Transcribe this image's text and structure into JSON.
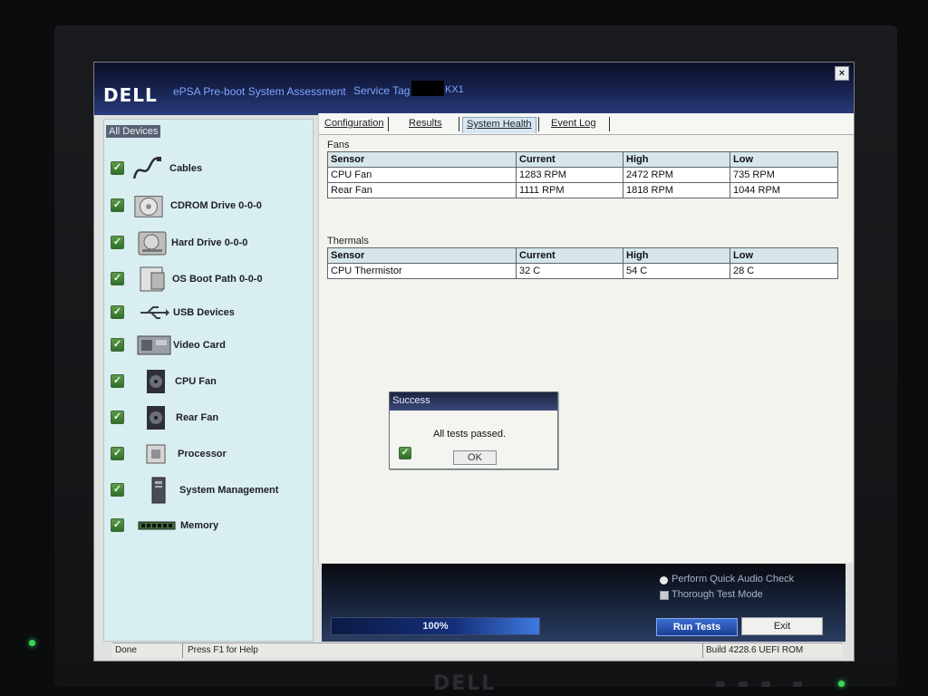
{
  "window": {
    "logo": "DELL",
    "app_title": "ePSA Pre-boot System Assessment",
    "service_tag_label": "Service Tag",
    "service_tag_suffix": "KX1",
    "close_label": "×"
  },
  "sidebar": {
    "header": "All Devices",
    "items": [
      {
        "label": "Cables",
        "icon": "cable-icon",
        "checked": true
      },
      {
        "label": "CDROM Drive 0-0-0",
        "icon": "cdrom-icon",
        "checked": true
      },
      {
        "label": "Hard Drive 0-0-0",
        "icon": "hard-drive-icon",
        "checked": true
      },
      {
        "label": "OS Boot Path 0-0-0",
        "icon": "boot-path-icon",
        "checked": true
      },
      {
        "label": "USB Devices",
        "icon": "usb-icon",
        "checked": true
      },
      {
        "label": "Video Card",
        "icon": "video-card-icon",
        "checked": true
      },
      {
        "label": "CPU Fan",
        "icon": "fan-icon",
        "checked": true
      },
      {
        "label": "Rear Fan",
        "icon": "fan-icon",
        "checked": true
      },
      {
        "label": "Processor",
        "icon": "processor-icon",
        "checked": true
      },
      {
        "label": "System Management",
        "icon": "system-management-icon",
        "checked": true
      },
      {
        "label": "Memory",
        "icon": "memory-icon",
        "checked": true
      }
    ]
  },
  "tabs": [
    {
      "label": "Configuration",
      "active": false
    },
    {
      "label": "Results",
      "active": false
    },
    {
      "label": "System Health",
      "active": true
    },
    {
      "label": "Event Log",
      "active": false
    }
  ],
  "fans": {
    "title": "Fans",
    "headers": [
      "Sensor",
      "Current",
      "High",
      "Low"
    ],
    "rows": [
      [
        "CPU Fan",
        "1283 RPM",
        "2472 RPM",
        "735 RPM"
      ],
      [
        "Rear Fan",
        "1111 RPM",
        "1818 RPM",
        "1044 RPM"
      ]
    ]
  },
  "thermals": {
    "title": "Thermals",
    "headers": [
      "Sensor",
      "Current",
      "High",
      "Low"
    ],
    "rows": [
      [
        "CPU Thermistor",
        "32 C",
        "54 C",
        "28 C"
      ]
    ]
  },
  "dialog": {
    "title": "Success",
    "message": "All tests passed.",
    "ok_label": "OK"
  },
  "controls": {
    "quick_audio_label": "Perform Quick Audio Check",
    "thorough_mode_label": "Thorough Test Mode",
    "progress_percent": 100,
    "progress_text": "100%",
    "run_tests_label": "Run Tests",
    "exit_label": "Exit"
  },
  "statusbar": {
    "status": "Done",
    "help": "Press F1 for Help",
    "build": "Build  4228.6 UEFI ROM"
  },
  "bezel": {
    "logo": "DELL"
  },
  "colors": {
    "title_bar": "#182452",
    "title_text": "#7ea7ff",
    "sidebar_bg": "#d9eef0",
    "check_green": "#3c7a34",
    "run_button": "#1a3f94"
  }
}
